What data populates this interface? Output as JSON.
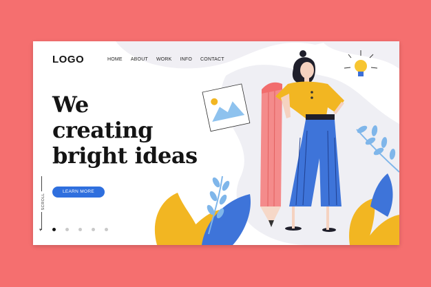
{
  "header": {
    "logo": "LOGO",
    "nav": [
      "HOME",
      "ABOUT",
      "WORK",
      "INFO",
      "CONTACT"
    ]
  },
  "hero": {
    "headline_lines": [
      "We",
      "creating",
      "bright ideas"
    ],
    "cta_label": "LEARN MORE",
    "scroll_label": "SCROLL"
  },
  "pagination": {
    "count": 5,
    "active_index": 0
  },
  "colors": {
    "background": "#f56f6f",
    "card": "#ffffff",
    "accent_blue": "#2f6fde",
    "yellow": "#f2b622",
    "pencil_pink": "#f48b8b",
    "leaf_light_blue": "#7fb6ea",
    "blob_grey": "#eeeef3"
  },
  "icons": [
    "lightbulb-icon",
    "image-icon",
    "arrow-down-icon"
  ]
}
